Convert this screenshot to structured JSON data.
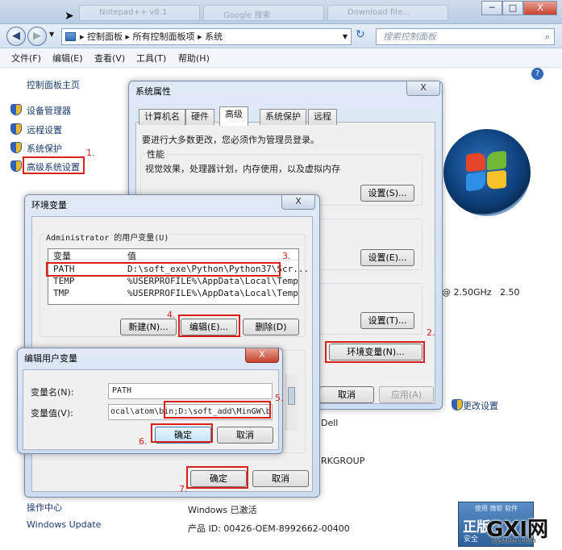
{
  "window": {
    "minimize_label": "─",
    "maximize_label": "□",
    "close_label": "X",
    "bg_tabs": [
      "Notepad++ v8.1",
      "Google 搜索",
      "Download file..."
    ]
  },
  "address": {
    "path": [
      "控制面板",
      "所有控制面板项",
      "系统"
    ],
    "search_placeholder": "搜索控制面板"
  },
  "menu": [
    "文件(F)",
    "编辑(E)",
    "查看(V)",
    "工具(T)",
    "帮助(H)"
  ],
  "sidebar": {
    "home": "控制面板主页",
    "items": [
      "设备管理器",
      "远程设置",
      "系统保护",
      "高级系统设置"
    ],
    "see_also": [
      "操作中心",
      "Windows Update"
    ]
  },
  "system_info": {
    "cpu_tail": "@ 2.50GHz   2.50",
    "manufacturer_tail": "Dell",
    "workgroup_tail": "RKGROUP",
    "activation": "Windows 已激活",
    "product_id": "产品 ID: 00426-OEM-8992662-00400",
    "change_settings": "更改设置",
    "genuine_top": "使用 微软 软件",
    "genuine": "正版",
    "genuine_sub": "安全",
    "watermark": "GXI网",
    "watermark_sub": "system.com"
  },
  "system_properties": {
    "title": "系统属性",
    "close": "X",
    "tabs": [
      "计算机名",
      "硬件",
      "高级",
      "系统保护",
      "远程"
    ],
    "notice": "要进行大多数更改，您必须作为管理员登录。",
    "perf_title": "性能",
    "perf_desc": "视觉效果，处理器计划，内存使用，以及虚拟内存",
    "perf_btn": "设置(S)...",
    "profile_btn": "设置(E)...",
    "startup_btn": "设置(T)...",
    "env_btn": "环境变量(N)...",
    "cancel": "取消",
    "apply": "应用(A)"
  },
  "env_vars": {
    "title": "环境变量",
    "close": "X",
    "user_group": "Administrator 的用户变量(U)",
    "col_var": "变量",
    "col_val": "值",
    "rows": [
      {
        "name": "PATH",
        "value": "D:\\soft_exe\\Python\\Python37\\Scr..."
      },
      {
        "name": "TEMP",
        "value": "%USERPROFILE%\\AppData\\Local\\Temp"
      },
      {
        "name": "TMP",
        "value": "%USERPROFILE%\\AppData\\Local\\Temp"
      }
    ],
    "new_btn": "新建(N)...",
    "edit_btn": "编辑(E)...",
    "delete_btn": "删除(D)",
    "ok": "确定",
    "cancel": "取消"
  },
  "edit_var": {
    "title": "编辑用户变量",
    "close": "X",
    "name_label": "变量名(N):",
    "value_label": "变量值(V):",
    "name_value": "PATH",
    "value_prefix": "ocal\\atom\\bin;",
    "value_added": "D:\\soft_add\\MinGW\\bin;",
    "ok": "确定",
    "cancel": "取消"
  },
  "annotations": [
    "1.",
    "2.",
    "3.",
    "4.",
    "5.",
    "6.",
    "7."
  ]
}
